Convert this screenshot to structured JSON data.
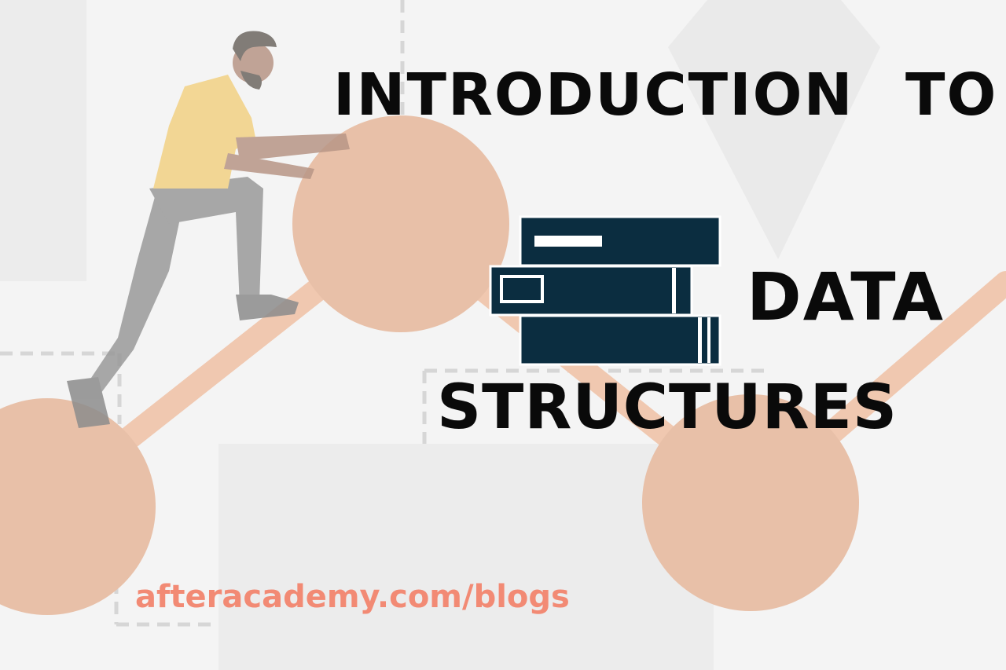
{
  "banner": {
    "title_line1": "INTRODUCTION",
    "title_line1b": "TO",
    "title_line2": "DATA",
    "title_line3": "STRUCTURES",
    "url": "afteracademy.com/blogs"
  },
  "icons": {
    "books": "books-stack-icon",
    "person": "climbing-person-illustration"
  },
  "colors": {
    "background": "#f4f4f4",
    "circle": "#e8c0a8",
    "connector": "#f0c8b0",
    "book": "#0b2d40",
    "url": "#f28a74",
    "text": "#0a0a0a"
  }
}
